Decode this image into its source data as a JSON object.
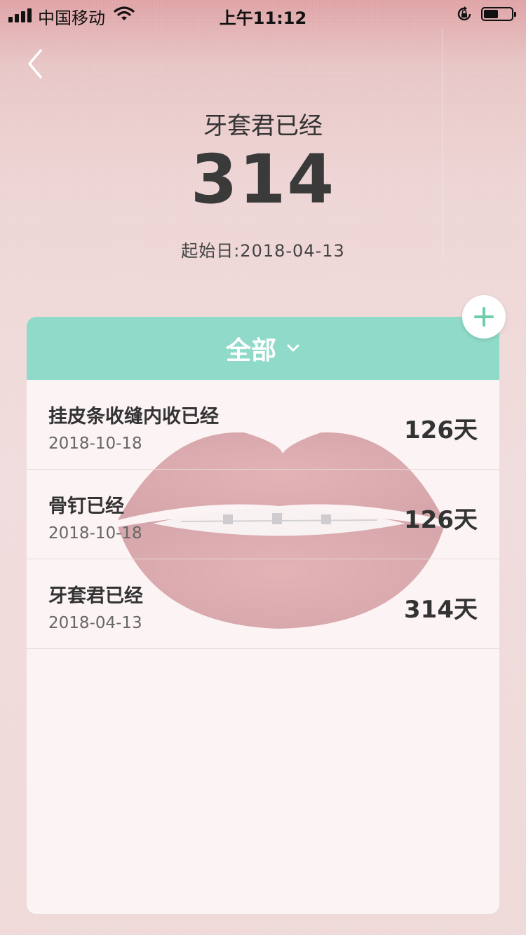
{
  "status_bar": {
    "carrier": "中国移动",
    "time": "上午11:12"
  },
  "hero": {
    "title": "牙套君已经",
    "count": "314",
    "start_date": "起始日:2018-04-13"
  },
  "filter": {
    "label": "全部"
  },
  "entries": [
    {
      "title": "挂皮条收缝内收已经",
      "date": "2018-10-18",
      "days": "126天"
    },
    {
      "title": "骨钉已经",
      "date": "2018-10-18",
      "days": "126天"
    },
    {
      "title": "牙套君已经",
      "date": "2018-04-13",
      "days": "314天"
    }
  ],
  "colors": {
    "header_accent": "#8fdac8",
    "add_icon": "#6ccfa9",
    "text_dark": "#333333"
  },
  "icons": {
    "back": "chevron-left-icon",
    "dropdown": "chevron-down-icon",
    "add": "plus-icon"
  }
}
